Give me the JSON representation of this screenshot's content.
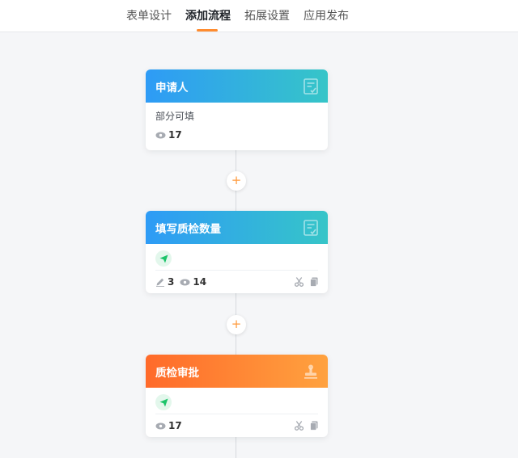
{
  "tabs": [
    {
      "label": "表单设计"
    },
    {
      "label": "添加流程"
    },
    {
      "label": "拓展设置"
    },
    {
      "label": "应用发布"
    }
  ],
  "add_button": {
    "symbol": "+"
  },
  "nodes": [
    {
      "title": "申请人",
      "subtitle": "部分可填",
      "view_count": "17"
    },
    {
      "title": "填写质检数量",
      "edit_count": "3",
      "view_count": "14"
    },
    {
      "title": "质检审批",
      "view_count": "17"
    }
  ],
  "colors": {
    "accent": "#ff8c2f",
    "header_blue_start": "#2e9bf6",
    "header_blue_end": "#36c5c8",
    "header_orange_start": "#ff6a2a",
    "header_orange_end": "#ffa23f",
    "send_green": "#1cc46a"
  }
}
